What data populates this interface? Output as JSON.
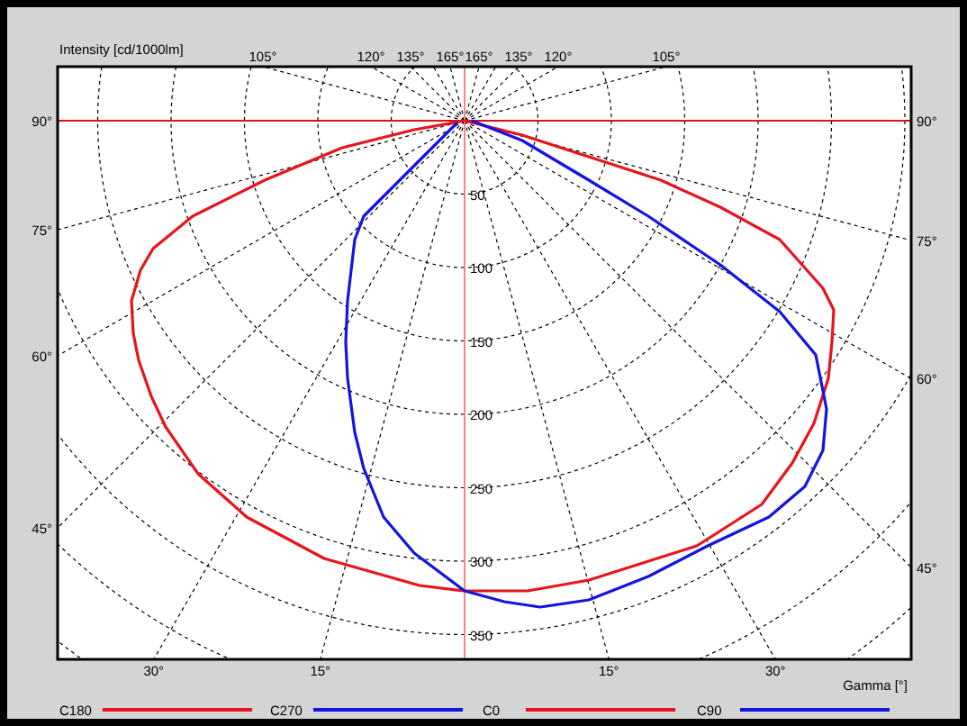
{
  "chart": {
    "ylabel": "Intensity [cd/1000lm]",
    "xlabel": "Gamma [°]",
    "top_angle_labels": [
      "105°",
      "120°",
      "135°",
      "165°",
      "165°",
      "135°",
      "120°",
      "105°"
    ],
    "left_angle_labels": [
      "90°",
      "75°",
      "60°",
      "45°"
    ],
    "right_angle_labels": [
      "90°",
      "75°",
      "60°",
      "45°"
    ],
    "bottom_angle_labels": [
      "30°",
      "15°",
      "15°",
      "30°"
    ],
    "radial_labels": [
      "50",
      "100",
      "150",
      "200",
      "250",
      "300",
      "350"
    ]
  },
  "legend": [
    {
      "name": "C180",
      "color": "#e8141c"
    },
    {
      "name": "C270",
      "color": "#1414e0"
    },
    {
      "name": "C0",
      "color": "#e8141c"
    },
    {
      "name": "C90",
      "color": "#1414e0"
    }
  ]
}
